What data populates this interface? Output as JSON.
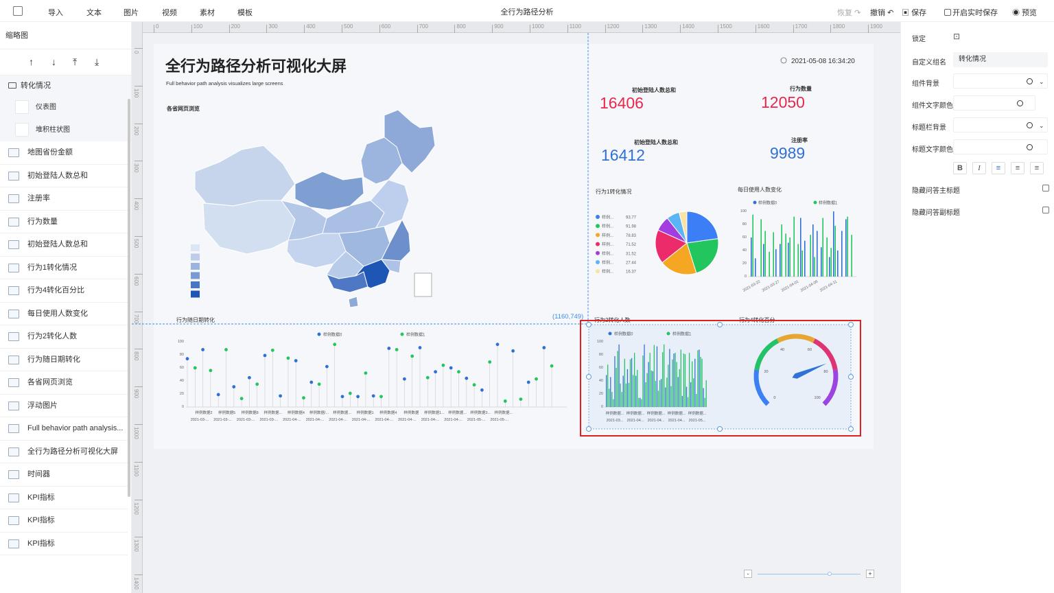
{
  "topbar": {
    "title": "全行为路径分析",
    "menu": [
      "导入",
      "文本",
      "图片",
      "视频",
      "素材",
      "模板"
    ],
    "restore": "恢复",
    "undo": "撤销",
    "save": "保存",
    "realtime": "开启实时保存",
    "preview": "预览"
  },
  "left": {
    "thumb_title": "缩略图",
    "group": "转化情况",
    "group_children": [
      "仪表图",
      "堆积柱状图"
    ],
    "layers": [
      "地图省份金额",
      "初始登陆人数总和",
      "注册率",
      "行为数量",
      "初始登陆人数总和",
      "行为1转化情况",
      "行为4转化百分比",
      "每日使用人数变化",
      "行为2转化人数",
      "行为随日期转化",
      "各省网页浏览",
      "浮动图片",
      "Full behavior path analysis...",
      "全行为路径分析可视化大屏",
      "时间器",
      "KPI指标",
      "KPI指标",
      "KPI指标"
    ]
  },
  "rulerx": [
    "100",
    "200",
    "300",
    "400",
    "500",
    "600",
    "700",
    "800",
    "900",
    "1000",
    "1100",
    "1200",
    "1300",
    "1400",
    "1500",
    "1600",
    "1700",
    "1800",
    "1900"
  ],
  "rulery": [
    "0",
    "100",
    "200",
    "300",
    "400",
    "500",
    "600",
    "700",
    "800",
    "900",
    "1000",
    "1100",
    "1200",
    "1300",
    "1400"
  ],
  "screen": {
    "title": "全行为路径分析可视化大屏",
    "subtitle": "Full behavior path analysis visualizes large screens",
    "datetime": "2021-05-08 16:34:20",
    "map_title": "各省网页浏览",
    "coord": "(1160,749)"
  },
  "kpis": [
    {
      "label": "初始登陆人数总和",
      "value": "16406",
      "color": "#e8284a"
    },
    {
      "label": "行为数量",
      "value": "12050",
      "color": "#e8284a"
    },
    {
      "label": "初始登陆人数总和",
      "value": "16412",
      "color": "#2f6fd6"
    },
    {
      "label": "注册率",
      "value": "9989",
      "color": "#2f6fd6"
    }
  ],
  "pie": {
    "title": "行为1转化情况",
    "items": [
      {
        "name": "样例...",
        "value": "93.77",
        "color": "#3b7ef5"
      },
      {
        "name": "样例...",
        "value": "91.98",
        "color": "#22c55e"
      },
      {
        "name": "样例...",
        "value": "78.83",
        "color": "#f5a623"
      },
      {
        "name": "样例...",
        "value": "71.52",
        "color": "#ec2c6a"
      },
      {
        "name": "样例...",
        "value": "31.52",
        "color": "#a33de0"
      },
      {
        "name": "样例...",
        "value": "27.44",
        "color": "#5ab4f5"
      },
      {
        "name": "样例...",
        "value": "16.37",
        "color": "#f9e3a3"
      }
    ]
  },
  "daily": {
    "title": "每日使用人数变化",
    "series": [
      "样例数据0",
      "样例数据1"
    ],
    "yticks": [
      "100",
      "80",
      "60",
      "40",
      "20",
      "0"
    ],
    "xticks": [
      "2021-03-22",
      "2021-03-27",
      "2021-04-01",
      "2021-04-06",
      "2021-04-11"
    ]
  },
  "date_conv": {
    "title": "行为随日期转化",
    "series": [
      "样例数据0",
      "样例数据1"
    ],
    "yticks": [
      "100",
      "80",
      "60",
      "40",
      "20",
      "0"
    ],
    "xl1": [
      "样例数据2",
      "样例数据5",
      "样例数据8",
      "样例数据...",
      "样例数据4",
      "样例数据/...",
      "样例数据...",
      "样例数据1",
      "样例数据4",
      "样例数据",
      "样例数据1...",
      "样例数据...",
      "样例数据3...",
      "样例数据..."
    ],
    "xl2": [
      "2021-03-...",
      "2021-03-...",
      "2021-03-...",
      "2021-03-...",
      "2021-04-...",
      "2021-04-...",
      "2021-04-...",
      "2021-04-...",
      "2021-04-...",
      "2021-04-...",
      "2021-04-...",
      "2021-04-...",
      "2021-05-...",
      "2021-05-..."
    ]
  },
  "stack": {
    "title": "行为2转化人数",
    "series": [
      "样例数据0",
      "样例数据1"
    ],
    "yticks": [
      "100",
      "80",
      "60",
      "40",
      "20",
      "0"
    ],
    "xl1": [
      "样例数据...",
      "样例数据...",
      "样例数据...",
      "样例数据...",
      "样例数据..."
    ],
    "xl2": [
      "2021-03...",
      "2021-04...",
      "2021-04...",
      "2021-04...",
      "2021-05..."
    ]
  },
  "gauge": {
    "title": "行为4转化百分",
    "ticks": [
      "0",
      "20",
      "40",
      "60",
      "80",
      "100"
    ],
    "value": 75
  },
  "right": {
    "lock": "锁定",
    "alias_label": "自定义组名",
    "alias": "转化情况",
    "bg": "组件背景",
    "text_color": "组件文字颜色",
    "title_bg": "标题栏背景",
    "title_color": "标题文字颜色",
    "hide_main": "隐藏问答主标题",
    "hide_sub": "隐藏问答副标题"
  },
  "colors": {
    "blue": "#2f6fd6",
    "green": "#22c55e",
    "selection": "#e02020"
  }
}
